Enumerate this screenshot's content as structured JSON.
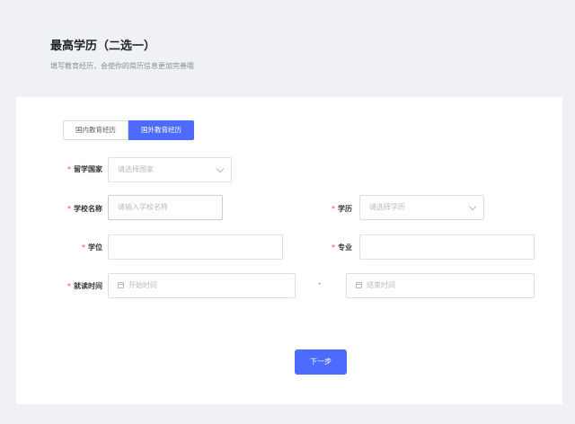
{
  "header": {
    "title": "最高学历（二选一）",
    "subtitle": "填写教育经历，会使你的简历信息更加完善哦"
  },
  "tabs": [
    {
      "label": "国内教育经历",
      "active": false
    },
    {
      "label": "国外教育经历",
      "active": true
    }
  ],
  "form": {
    "required_mark": "*",
    "country": {
      "label": "留学国家",
      "placeholder": "请选择国家"
    },
    "school": {
      "label": "学校名称",
      "placeholder": "请输入学校名称"
    },
    "education": {
      "label": "学历",
      "placeholder": "请选择学历"
    },
    "degree": {
      "label": "学位",
      "value": ""
    },
    "major": {
      "label": "专业",
      "value": ""
    },
    "period": {
      "label": "就读时间",
      "start_placeholder": "开始时间",
      "separator": "-",
      "end_placeholder": "结束时间"
    }
  },
  "actions": {
    "next_label": "下一步"
  },
  "colors": {
    "primary": "#4d6bfe",
    "required": "#f04747",
    "background": "#f0f1f4"
  }
}
